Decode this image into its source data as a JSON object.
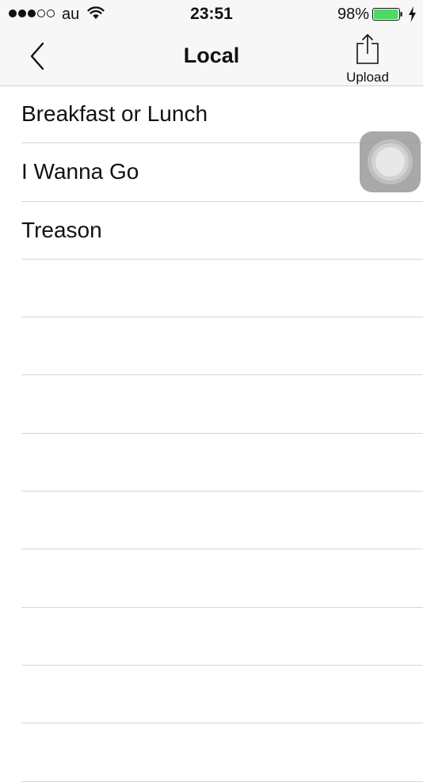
{
  "status_bar": {
    "signal_bars_filled": 3,
    "signal_bars_total": 5,
    "carrier": "au",
    "time": "23:51",
    "battery_percent_label": "98%",
    "battery_level": 0.98,
    "battery_color": "#4cd964",
    "charging": true
  },
  "nav": {
    "back_icon": "chevron-left-icon",
    "title": "Local",
    "upload_icon": "share-upload-icon",
    "upload_label": "Upload"
  },
  "list": {
    "items": [
      {
        "label": "Breakfast or Lunch"
      },
      {
        "label": "I Wanna Go"
      },
      {
        "label": "Treason"
      },
      {
        "label": ""
      },
      {
        "label": ""
      },
      {
        "label": ""
      },
      {
        "label": ""
      },
      {
        "label": ""
      },
      {
        "label": ""
      },
      {
        "label": ""
      },
      {
        "label": ""
      },
      {
        "label": ""
      }
    ]
  },
  "assistive_touch": {
    "icon": "assistive-touch-icon"
  }
}
